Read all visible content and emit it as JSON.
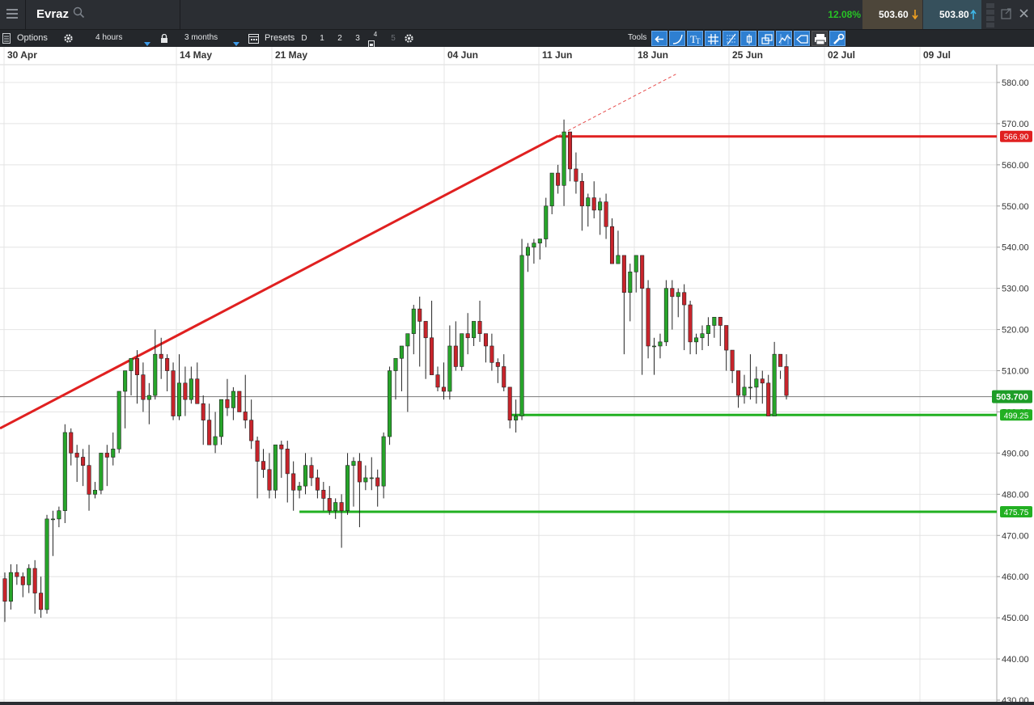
{
  "header": {
    "instrument": "Evraz",
    "change_pct": "12.08%",
    "sell_price": "503.60",
    "buy_price": "503.80"
  },
  "toolbar": {
    "options_label": "Options",
    "interval": "4 hours",
    "range": "3 months",
    "presets_label": "Presets",
    "preset_buttons": [
      "D",
      "1",
      "2",
      "3",
      "4",
      "5"
    ],
    "tools_label": "Tools"
  },
  "colors": {
    "up": "#27a52a",
    "down": "#c8242b",
    "resistance": "#e02020",
    "support": "#22b022",
    "price_line": "#7a7a7a",
    "grid": "#e4e4e4"
  },
  "chart_data": {
    "type": "candlestick",
    "y_range": [
      430,
      580
    ],
    "y_ticks": [
      "430.00",
      "440.00",
      "450.00",
      "460.00",
      "470.00",
      "480.00",
      "490.00",
      "500.00",
      "510.00",
      "520.00",
      "530.00",
      "540.00",
      "550.00",
      "560.00",
      "570.00",
      "580.00"
    ],
    "x_ticks": [
      "30 Apr",
      "14 May",
      "21 May",
      "04 Jun",
      "11 Jun",
      "18 Jun",
      "25 Jun",
      "02 Jul",
      "09 Jul"
    ],
    "grid": true,
    "current_price": "503.700",
    "horizontal_lines": [
      {
        "price": 566.9,
        "label": "566.90",
        "kind": "resistance"
      },
      {
        "price": 499.25,
        "label": "499.25",
        "kind": "support"
      },
      {
        "price": 475.75,
        "label": "475.75",
        "kind": "support"
      }
    ],
    "trendline": {
      "from_price": 496,
      "to_price": 567,
      "kind": "resistance",
      "extension": "dashed"
    },
    "candles": [
      [
        459.5,
        461,
        449,
        454
      ],
      [
        454,
        463,
        452,
        461
      ],
      [
        461,
        463,
        458,
        460
      ],
      [
        460,
        461,
        455,
        458
      ],
      [
        458,
        463,
        456,
        462
      ],
      [
        462,
        464,
        451,
        456
      ],
      [
        456,
        460,
        450,
        452
      ],
      [
        452,
        475,
        451,
        474
      ],
      [
        474,
        476,
        465,
        474
      ],
      [
        474,
        477,
        472,
        476
      ],
      [
        476,
        497,
        473,
        495
      ],
      [
        495,
        496,
        487,
        490
      ],
      [
        490,
        492,
        483,
        489
      ],
      [
        489,
        491,
        482,
        487
      ],
      [
        487,
        492,
        476,
        480
      ],
      [
        480,
        483,
        479,
        481
      ],
      [
        481,
        490,
        480,
        490
      ],
      [
        490,
        492,
        482,
        489
      ],
      [
        489,
        495,
        487,
        491
      ],
      [
        491,
        505,
        490,
        505
      ],
      [
        505,
        510,
        496,
        510
      ],
      [
        510,
        513,
        504,
        513
      ],
      [
        513,
        515,
        502,
        509
      ],
      [
        509,
        512,
        500,
        503
      ],
      [
        503,
        507,
        497,
        504
      ],
      [
        504,
        520,
        503,
        514
      ],
      [
        514,
        518,
        508,
        513
      ],
      [
        513,
        514,
        505,
        510
      ],
      [
        510,
        512,
        498,
        499
      ],
      [
        499,
        514,
        498,
        507
      ],
      [
        507,
        511,
        499,
        503
      ],
      [
        503,
        511,
        502,
        508
      ],
      [
        508,
        512,
        505,
        502
      ],
      [
        502,
        504,
        492,
        498
      ],
      [
        498,
        502,
        492,
        492
      ],
      [
        492,
        500,
        490,
        494
      ],
      [
        494,
        502,
        492,
        503
      ],
      [
        503,
        508,
        499,
        501
      ],
      [
        501,
        506,
        498,
        505
      ],
      [
        505,
        505,
        500,
        500
      ],
      [
        500,
        509,
        496,
        498
      ],
      [
        498,
        503,
        491,
        493
      ],
      [
        493,
        494,
        479,
        488
      ],
      [
        488,
        491,
        484,
        486
      ],
      [
        486,
        490,
        479,
        481
      ],
      [
        481,
        492,
        479,
        492
      ],
      [
        492,
        493,
        484,
        491
      ],
      [
        491,
        493,
        478,
        485
      ],
      [
        485,
        488,
        476,
        481
      ],
      [
        481,
        483,
        479,
        482
      ],
      [
        482,
        490,
        480,
        487
      ],
      [
        487,
        489,
        482,
        484
      ],
      [
        484,
        486,
        479,
        481
      ],
      [
        481,
        483,
        476,
        479
      ],
      [
        479,
        482,
        475,
        476
      ],
      [
        476,
        479,
        474,
        478
      ],
      [
        478,
        480,
        467,
        476
      ],
      [
        476,
        490,
        475,
        487
      ],
      [
        487,
        489,
        477,
        488
      ],
      [
        488,
        490,
        472,
        483
      ],
      [
        483,
        487,
        481,
        484
      ],
      [
        484,
        489,
        481,
        484
      ],
      [
        484,
        486,
        477,
        482
      ],
      [
        482,
        495,
        479,
        494
      ],
      [
        494,
        511,
        492,
        510
      ],
      [
        510,
        512,
        503,
        513
      ],
      [
        513,
        514,
        505,
        516
      ],
      [
        516,
        519,
        500,
        519
      ],
      [
        519,
        526,
        514,
        525
      ],
      [
        525,
        528,
        511,
        522
      ],
      [
        522,
        522,
        508,
        518
      ],
      [
        518,
        527,
        511,
        509
      ],
      [
        509,
        511,
        505,
        506
      ],
      [
        506,
        512,
        503,
        505
      ],
      [
        505,
        521,
        503,
        516
      ],
      [
        516,
        522,
        510,
        511
      ],
      [
        511,
        519,
        510,
        519
      ],
      [
        519,
        524,
        514,
        518
      ],
      [
        518,
        521,
        516,
        522
      ],
      [
        522,
        527,
        517,
        519
      ],
      [
        519,
        519,
        512,
        516
      ],
      [
        516,
        519,
        510,
        512
      ],
      [
        512,
        513,
        507,
        511
      ],
      [
        511,
        514,
        505,
        506
      ],
      [
        506,
        505,
        496,
        498
      ],
      [
        498,
        503,
        495,
        499
      ],
      [
        499,
        542,
        498,
        538
      ],
      [
        538,
        541,
        534,
        540
      ],
      [
        540,
        542,
        536,
        541
      ],
      [
        541,
        542,
        537,
        542
      ],
      [
        542,
        552,
        540,
        550
      ],
      [
        550,
        557,
        548,
        558
      ],
      [
        558,
        560,
        553,
        555
      ],
      [
        555,
        571,
        550,
        568
      ],
      [
        568,
        566,
        556,
        559
      ],
      [
        559,
        563,
        553,
        556
      ],
      [
        556,
        558,
        544,
        550
      ],
      [
        550,
        553,
        545,
        552
      ],
      [
        552,
        556,
        547,
        549
      ],
      [
        549,
        552,
        543,
        551
      ],
      [
        551,
        553,
        542,
        545
      ],
      [
        545,
        547,
        538,
        536
      ],
      [
        536,
        544,
        536,
        538
      ],
      [
        538,
        533,
        514,
        529
      ],
      [
        529,
        536,
        522,
        534
      ],
      [
        534,
        538,
        529,
        538
      ],
      [
        538,
        536,
        509,
        530
      ],
      [
        530,
        532,
        513,
        516
      ],
      [
        516,
        518,
        509,
        516
      ],
      [
        516,
        519,
        513,
        517
      ],
      [
        517,
        532,
        516,
        530
      ],
      [
        530,
        532,
        520,
        528
      ],
      [
        528,
        530,
        523,
        529
      ],
      [
        529,
        531,
        515,
        526
      ],
      [
        526,
        527,
        514,
        517
      ],
      [
        517,
        519,
        514,
        518
      ],
      [
        518,
        521,
        515,
        519
      ],
      [
        519,
        523,
        516,
        521
      ],
      [
        521,
        522,
        518,
        523
      ],
      [
        523,
        523,
        516,
        521
      ],
      [
        521,
        518,
        510,
        515
      ],
      [
        515,
        513,
        507,
        510
      ],
      [
        510,
        510,
        501,
        504
      ],
      [
        504,
        509,
        502,
        506
      ],
      [
        506,
        514,
        503,
        506
      ],
      [
        506,
        511,
        502,
        508
      ],
      [
        508,
        510,
        502,
        507
      ],
      [
        507,
        509,
        499,
        499
      ],
      [
        499,
        517,
        504,
        514
      ],
      [
        514,
        510,
        508,
        511
      ],
      [
        511,
        514,
        503,
        504
      ]
    ]
  }
}
